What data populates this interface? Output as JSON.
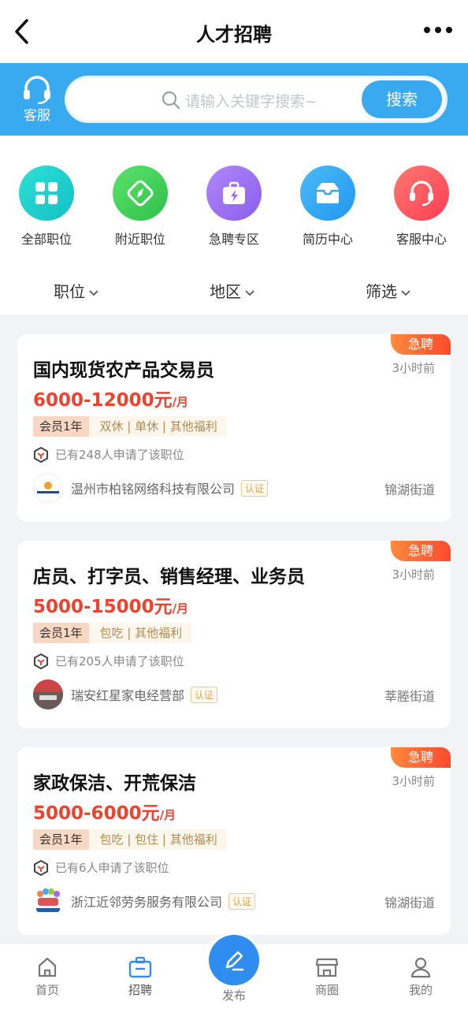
{
  "header": {
    "title": "人才招聘",
    "back_icon": "back-icon",
    "more_icon": "more-icon"
  },
  "search": {
    "cs_label": "客服",
    "placeholder": "请输入关键字搜索~",
    "button": "搜索"
  },
  "categories": [
    {
      "label": "全部职位",
      "icon": "grid-icon",
      "color": "#21d0c9"
    },
    {
      "label": "附近职位",
      "icon": "compass-icon",
      "color": "#3ed359"
    },
    {
      "label": "急聘专区",
      "icon": "briefcase-bolt-icon",
      "color": "#9a6df2"
    },
    {
      "label": "简历中心",
      "icon": "inbox-icon",
      "color": "#2ea8f2"
    },
    {
      "label": "客服中心",
      "icon": "headset-icon",
      "color": "#ff4f5a"
    }
  ],
  "filters": [
    {
      "label": "职位"
    },
    {
      "label": "地区"
    },
    {
      "label": "筛选"
    }
  ],
  "jobs": [
    {
      "badge": "急聘",
      "title": "国内现货农产品交易员",
      "time": "3小时前",
      "salary": "6000-12000元",
      "unit": "/月",
      "member": "会员1年",
      "perks": "双休 | 单休 | 其他福利",
      "applied": "已有248人申请了该职位",
      "company": "温州市柏铭网络科技有限公司",
      "cert": "认证",
      "street": "锦湖街道"
    },
    {
      "badge": "急聘",
      "title": "店员、打字员、销售经理、业务员",
      "time": "3小时前",
      "salary": "5000-15000元",
      "unit": "/月",
      "member": "会员1年",
      "perks": "包吃 | 其他福利",
      "applied": "已有205人申请了该职位",
      "company": "瑞安红星家电经营部",
      "cert": "认证",
      "street": "莘塍街道"
    },
    {
      "badge": "急聘",
      "title": "家政保洁、开荒保洁",
      "time": "3小时前",
      "salary": "5000-6000元",
      "unit": "/月",
      "member": "会员1年",
      "perks": "包吃 | 包住 | 其他福利",
      "applied": "已有6人申请了该职位",
      "company": "浙江近邻劳务服务有限公司",
      "cert": "认证",
      "street": "锦湖街道"
    }
  ],
  "nav": [
    {
      "label": "首页",
      "icon": "home-icon"
    },
    {
      "label": "招聘",
      "icon": "briefcase-icon"
    },
    {
      "label": "发布",
      "icon": "pen-icon"
    },
    {
      "label": "商圈",
      "icon": "shop-icon"
    },
    {
      "label": "我的",
      "icon": "user-icon"
    }
  ],
  "colors": {
    "primary": "#39aaf0",
    "salary": "#e8442f",
    "badge": "#ff5a2e"
  }
}
